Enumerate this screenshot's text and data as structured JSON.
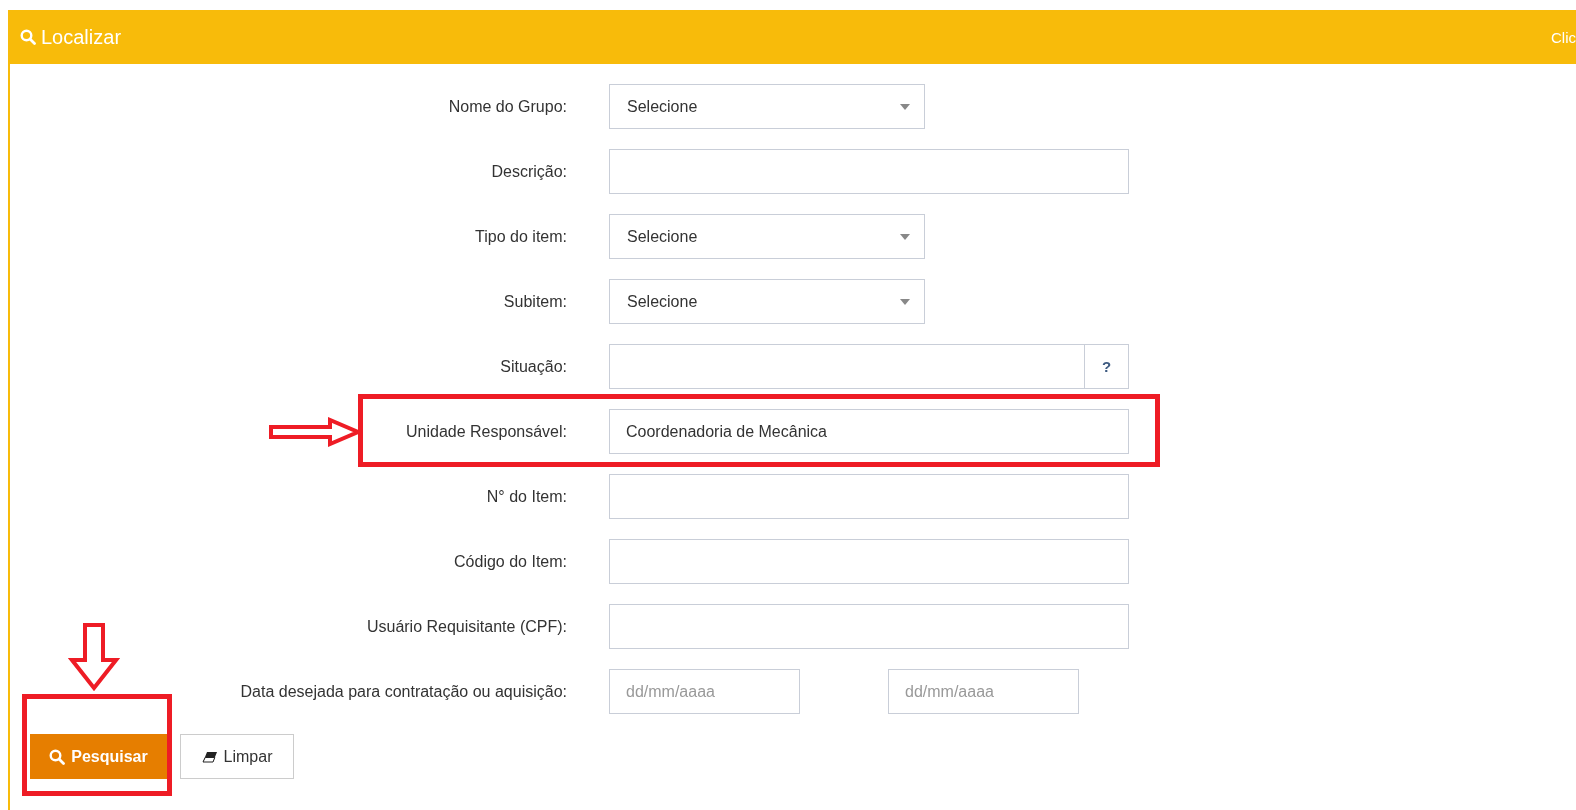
{
  "panel": {
    "title": "Localizar",
    "hint": "Clic"
  },
  "fields": [
    {
      "kind": "select",
      "label": "Nome do Grupo:",
      "value": "Selecione",
      "highlighted": false
    },
    {
      "kind": "text",
      "label": "Descrição:",
      "highlighted": false
    },
    {
      "kind": "select",
      "label": "Tipo do item:",
      "value": "Selecione",
      "highlighted": false
    },
    {
      "kind": "select",
      "label": "Subitem:",
      "value": "Selecione",
      "highlighted": false
    },
    {
      "kind": "addon",
      "label": "Situação:",
      "addon": "?",
      "highlighted": false
    },
    {
      "kind": "text",
      "label": "Unidade Responsável:",
      "value": "Coordenadoria de Mecânica",
      "highlighted": true
    },
    {
      "kind": "text",
      "label": "N° do Item:",
      "highlighted": false
    },
    {
      "kind": "text",
      "label": "Código do Item:",
      "highlighted": false
    },
    {
      "kind": "text",
      "label": "Usuário Requisitante (CPF):",
      "highlighted": false
    },
    {
      "kind": "daterange",
      "label": "Data desejada para contratação ou aquisição:",
      "from_placeholder": "dd/mm/aaaa",
      "to_placeholder": "dd/mm/aaaa",
      "highlighted": false
    }
  ],
  "buttons": [
    {
      "kind": "primary",
      "label": "Pesquisar",
      "highlighted": true
    },
    {
      "kind": "clear",
      "label": "Limpar",
      "highlighted": false
    }
  ]
}
